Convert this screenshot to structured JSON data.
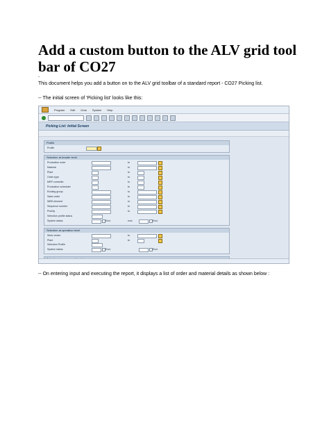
{
  "doc": {
    "title": "Add a custom button to the ALV grid tool bar of CO27",
    "dash": "-",
    "intro": "This document helps you add a button on to the ALV grid toolbar of a standard report - CO27 Picking list.",
    "initial_screen_caption": "-- The initial screen of 'Picking list' looks like this:",
    "after_caption": "-- On entering input and executing the report, it displays a list of order and material details as shown below :"
  },
  "sap": {
    "menu": [
      "Program",
      "Edit",
      "Goto",
      "System",
      "Help"
    ],
    "screen_title": "Picking List: Initial Screen",
    "profile_group": "Profile",
    "profile_label": "Profile",
    "header_group": "Selection at header level",
    "header_fields": [
      "Production order",
      "Material",
      "Plant",
      "Order type",
      "MRP controller",
      "Production scheduler",
      "Routing group",
      "Sales order",
      "WBS element",
      "Sequence number",
      "Priority",
      "Selection profile status",
      "System status"
    ],
    "to_label": "to",
    "excl_label": "Excl.",
    "excl2_label": "excl.",
    "op_group": "Selection at operation level",
    "op_fields": [
      "Work center",
      "Plant",
      "Selection Profile",
      "System status"
    ],
    "component_group": "Selection at component level"
  }
}
